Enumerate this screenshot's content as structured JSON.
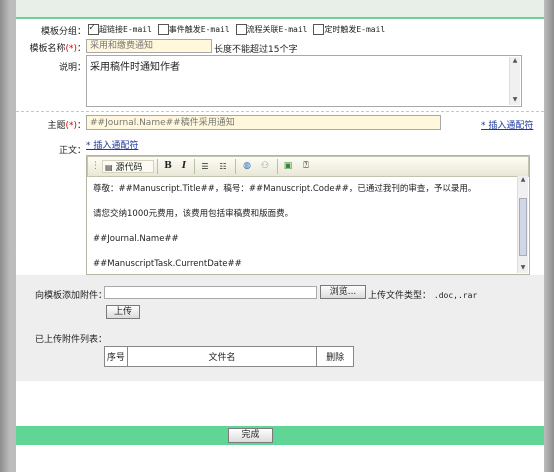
{
  "form": {
    "template_group": {
      "label": "模板分组：",
      "options": [
        {
          "label": "超链接E-mail",
          "checked": true
        },
        {
          "label": "事件触发E-mail",
          "checked": false
        },
        {
          "label": "流程关联E-mail",
          "checked": false
        },
        {
          "label": "定时触发E-mail",
          "checked": false
        }
      ]
    },
    "template_name": {
      "label": "模板名称",
      "required_mark": "(*)",
      "colon": "：",
      "value": "采用和缴费通知",
      "hint": "长度不能超过15个字"
    },
    "description": {
      "label": "说明：",
      "value": "采用稿件时通知作者"
    },
    "subject": {
      "label": "主题",
      "required_mark": "(*)",
      "colon": "：",
      "value": "##Journal.Name##稿件采用通知",
      "insert_link": "* 插入通配符"
    },
    "body": {
      "label": "正文：",
      "insert_link": "* 插入通配符",
      "toolbar": {
        "source_label": "源代码",
        "bold": "B",
        "italic": "I"
      },
      "lines": [
        "尊敬：##Manuscript.Title##，稿号：##Manuscript.Code##，已通过我刊的审查，予以录用。",
        "请您交纳1000元费用，该费用包括审稿费和版面费。",
        "##Journal.Name##",
        "##ManuscriptTask.CurrentDate##"
      ]
    },
    "attachment": {
      "label": "向模板添加附件：",
      "browse_button": "浏览...",
      "types_label": "上传文件类型：",
      "types_value": ".doc,.rar",
      "upload_button": "上传"
    },
    "uploaded": {
      "label": "已上传附件列表：",
      "columns": [
        "序号",
        "文件名",
        "删除"
      ]
    },
    "finish_button": "完成"
  },
  "icons": [
    "source-code-icon",
    "bold-icon",
    "italic-icon",
    "ordered-list-icon",
    "unordered-list-icon",
    "globe-link-icon",
    "unlink-icon",
    "image-icon",
    "help-icon"
  ],
  "colors": {
    "accent_bar": "#5fd596",
    "link": "#1f3a9c",
    "required": "#dd0000",
    "input_highlight": "#fff8dc"
  }
}
